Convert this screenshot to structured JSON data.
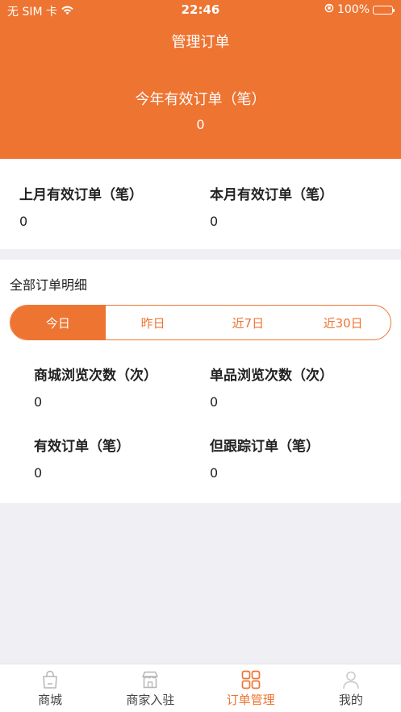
{
  "status_bar": {
    "carrier": "无 SIM 卡",
    "time": "22:46",
    "battery": "100%"
  },
  "header": {
    "title": "管理订单",
    "year_orders_label": "今年有效订单（笔）",
    "year_orders_value": "0"
  },
  "monthly": {
    "last_month_label": "上月有效订单（笔）",
    "last_month_value": "0",
    "this_month_label": "本月有效订单（笔）",
    "this_month_value": "0"
  },
  "details": {
    "title": "全部订单明细",
    "segments": [
      "今日",
      "昨日",
      "近7日",
      "近30日"
    ],
    "active_segment": "今日",
    "stats": {
      "mall_views_label": "商城浏览次数（次）",
      "mall_views_value": "0",
      "product_views_label": "单品浏览次数（次）",
      "product_views_value": "0",
      "valid_orders_label": "有效订单（笔）",
      "valid_orders_value": "0",
      "tracked_orders_label": "但跟踪订单（笔）",
      "tracked_orders_value": "0"
    }
  },
  "tabbar": {
    "items": [
      {
        "label": "商城",
        "icon": "shopping-bag-icon"
      },
      {
        "label": "商家入驻",
        "icon": "storefront-icon"
      },
      {
        "label": "订单管理",
        "icon": "grid-icon"
      },
      {
        "label": "我的",
        "icon": "user-icon"
      }
    ],
    "active_index": 2
  },
  "colors": {
    "accent": "#ee7431",
    "background": "#efeff4",
    "card": "#ffffff",
    "text": "#222222",
    "inactive_tab": "#444444"
  }
}
